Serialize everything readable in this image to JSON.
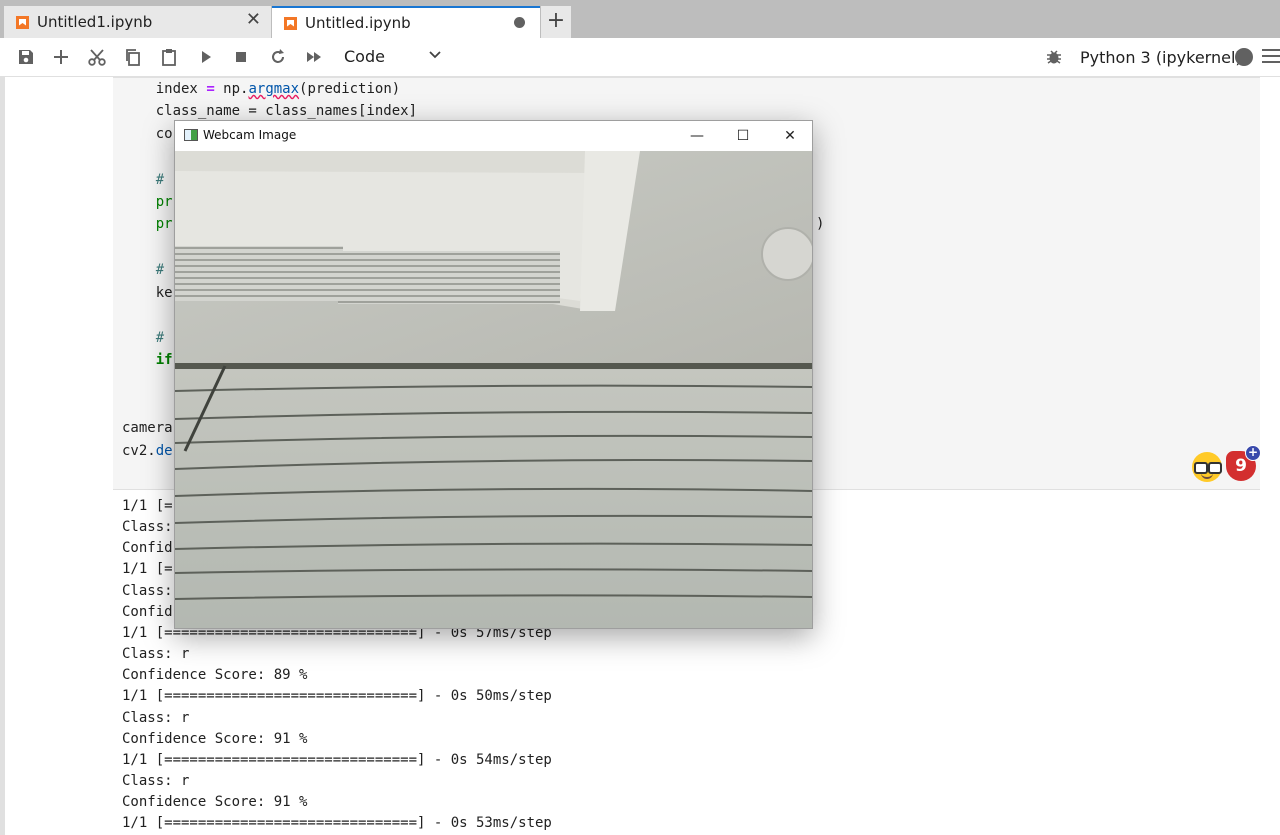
{
  "tabs": [
    {
      "label": "Untitled1.ipynb",
      "state": "close"
    },
    {
      "label": "Untitled.ipynb",
      "state": "unsaved"
    }
  ],
  "new_tab_label": "+",
  "toolbar": {
    "cell_type": "Code",
    "kernel": "Python 3 (ipykernel)"
  },
  "code_lines": {
    "l1_var": "index",
    "l1_eq": "=",
    "l1_pre": " np.",
    "l1_fn": "argmax",
    "l1_post": "(prediction)",
    "l2": "class_name = class_names[index]",
    "l3": "co",
    "l4": "#",
    "l5": "pr",
    "l6": "pr",
    "l6_tail": ")",
    "l7": "#",
    "l8": "ke",
    "l9": "#",
    "l10": "if",
    "l11": "camera",
    "l12_pre": "cv2.",
    "l12_fn": "de"
  },
  "output_lines": [
    "1/1 [=",
    "Class:",
    "Confid",
    "1/1 [=",
    "Class:",
    "Confid",
    "1/1 [==============================] - 0s 57ms/step",
    "Class: r",
    "Confidence Score: 89 %",
    "1/1 [==============================] - 0s 50ms/step",
    "Class: r",
    "Confidence Score: 91 %",
    "1/1 [==============================] - 0s 54ms/step",
    "Class: r",
    "Confidence Score: 91 %",
    "1/1 [==============================] - 0s 53ms/step"
  ],
  "badge": {
    "count": "9",
    "plus": "+"
  },
  "webcam_window": {
    "title": "Webcam Image",
    "minimize": "—",
    "maximize": "☐",
    "close": "✕"
  },
  "colors": {
    "tab_active_accent": "#1976d2",
    "notebook_icon": "#f37726",
    "keyword": "#008000",
    "operator": "#aa22ff",
    "badge": "#d32f2f"
  },
  "icons": [
    "save-icon",
    "add-icon",
    "cut-icon",
    "copy-icon",
    "paste-icon",
    "run-icon",
    "stop-icon",
    "restart-icon",
    "run-all-icon",
    "chevron-down-icon",
    "bug-icon",
    "kernel-status-icon",
    "menu-icon"
  ]
}
